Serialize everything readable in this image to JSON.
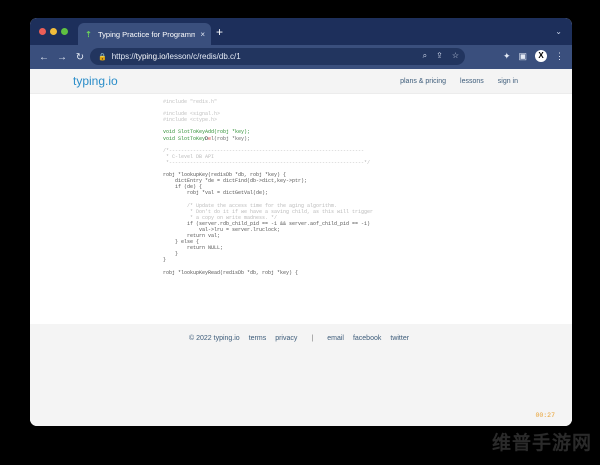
{
  "browser": {
    "tab_title": "Typing Practice for Programme",
    "tab_close": "×",
    "new_tab": "+",
    "url_prefix": "https://",
    "url_host": "typing.io",
    "url_path": "/lesson/c/redis/db.c/1",
    "profile_initial": "X"
  },
  "site": {
    "logo_main": "typing",
    "logo_io": ".io",
    "nav": [
      "plans & pricing",
      "lessons",
      "sign in"
    ]
  },
  "code_lines": [
    {
      "kind": "dim",
      "text": "#include \"redis.h\""
    },
    {
      "kind": "dim",
      "text": ""
    },
    {
      "kind": "dim",
      "text": "#include <signal.h>"
    },
    {
      "kind": "dim",
      "text": "#include <ctype.h>"
    },
    {
      "kind": "dim",
      "text": ""
    },
    {
      "kind": "typed",
      "text": "void SlotToKeyAdd(robj *key);"
    },
    {
      "kind": "partial",
      "typed": "void SlotToKey",
      "cursor": "D",
      "err": "e",
      "rest": "l(robj *key);"
    },
    {
      "kind": "dim",
      "text": ""
    },
    {
      "kind": "sep",
      "text": "/*-----------------------------------------------------------------"
    },
    {
      "kind": "sep",
      "text": " * C-level DB API"
    },
    {
      "kind": "sep",
      "text": " *-----------------------------------------------------------------*/"
    },
    {
      "kind": "dim",
      "text": ""
    },
    {
      "kind": "norm",
      "text": "robj *lookupKey(redisDb *db, robj *key) {"
    },
    {
      "kind": "norm",
      "text": "    dictEntry *de = dictFind(db->dict,key->ptr);"
    },
    {
      "kind": "norm",
      "text": "    if (de) {"
    },
    {
      "kind": "norm",
      "text": "        robj *val = dictGetVal(de);"
    },
    {
      "kind": "dim",
      "text": ""
    },
    {
      "kind": "sep",
      "text": "        /* Update the access time for the aging algorithm."
    },
    {
      "kind": "sep",
      "text": "         * Don't do it if we have a saving child, as this will trigger"
    },
    {
      "kind": "sep",
      "text": "         * a copy on write madness. */"
    },
    {
      "kind": "norm",
      "text": "        if (server.rdb_child_pid == -1 && server.aof_child_pid == -1)"
    },
    {
      "kind": "norm",
      "text": "            val->lru = server.lruclock;"
    },
    {
      "kind": "norm",
      "text": "        return val;"
    },
    {
      "kind": "norm",
      "text": "    } else {"
    },
    {
      "kind": "norm",
      "text": "        return NULL;"
    },
    {
      "kind": "norm",
      "text": "    }"
    },
    {
      "kind": "norm",
      "text": "}"
    },
    {
      "kind": "dim",
      "text": ""
    },
    {
      "kind": "norm",
      "text": "robj *lookupKeyRead(redisDb *db, robj *key) {"
    }
  ],
  "footer": {
    "copyright": "© 2022 typing.io",
    "terms": "terms",
    "privacy": "privacy",
    "pipe": "|",
    "email": "email",
    "facebook": "facebook",
    "twitter": "twitter"
  },
  "timer": "00:27",
  "watermark": "维普手游网",
  "colors": {
    "tabbar": "#1d2f5b",
    "toolbar": "#3a4f7d",
    "logo": "#2a8dc9",
    "typed": "#2f8f35",
    "error": "#d23c3c",
    "timer": "#e8a030"
  }
}
